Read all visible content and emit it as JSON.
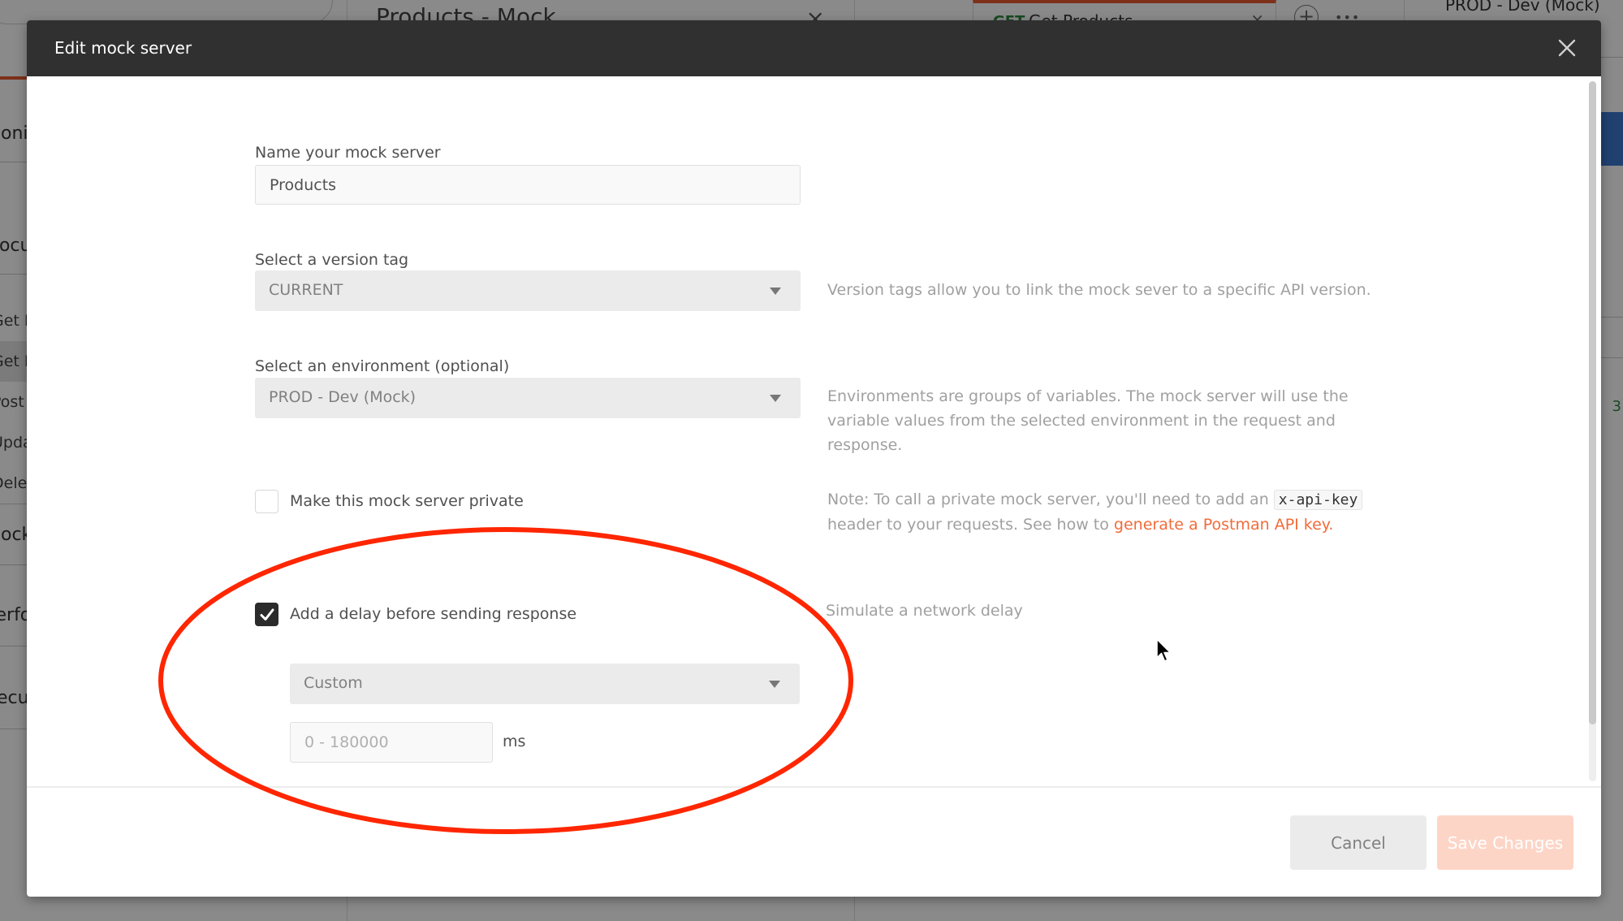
{
  "background": {
    "sidebar_items": [
      {
        "label": "Monitors"
      },
      {
        "label": "Documentation"
      },
      {
        "label": "Mock Servers"
      },
      {
        "label": "Performance"
      },
      {
        "label": "Security"
      }
    ],
    "sidebar_subitems": [
      {
        "label": "Get Product",
        "active": false
      },
      {
        "label": "Get Products",
        "active": true
      },
      {
        "label": "Post Product",
        "active": false
      },
      {
        "label": "Update Product",
        "active": false
      },
      {
        "label": "Delete Product",
        "active": false
      }
    ],
    "center_title": "Products - Mock",
    "center_close": "×",
    "tab": {
      "method": "GET",
      "name": "Get Products",
      "close": "×"
    },
    "add_tab": "+",
    "more": "•••",
    "environment": "PROD - Dev (Mock)",
    "status_code_fragment": "3"
  },
  "modal": {
    "title": "Edit mock server",
    "close_icon": "close-icon",
    "name_field": {
      "label": "Name your mock server",
      "value": "Products"
    },
    "version_tag": {
      "label": "Select a version tag",
      "selected": "CURRENT",
      "help": "Version tags allow you to link the mock sever to a specific API version."
    },
    "environment": {
      "label": "Select an environment (optional)",
      "selected": "PROD - Dev (Mock)",
      "help": "Environments are groups of variables. The mock server will use the variable values from the selected environment in the request and response."
    },
    "private": {
      "label": "Make this mock server private",
      "checked": false,
      "note_prefix": "Note: To call a private mock server, you'll need to add an",
      "note_code": "x-api-key",
      "note_middle": "header to your requests. See how to",
      "note_link": "generate a Postman API key."
    },
    "delay": {
      "label": "Add a delay before sending response",
      "checked": true,
      "help": "Simulate a network delay",
      "type_selected": "Custom",
      "ms_placeholder": "0 - 180000",
      "ms_value": "",
      "unit": "ms"
    },
    "footer": {
      "cancel_label": "Cancel",
      "save_label": "Save Changes"
    }
  },
  "colors": {
    "header_bg": "#303030",
    "accent": "#f26b3a",
    "save_disabled": "#fdd5c7",
    "annotation": "#ff2600"
  }
}
